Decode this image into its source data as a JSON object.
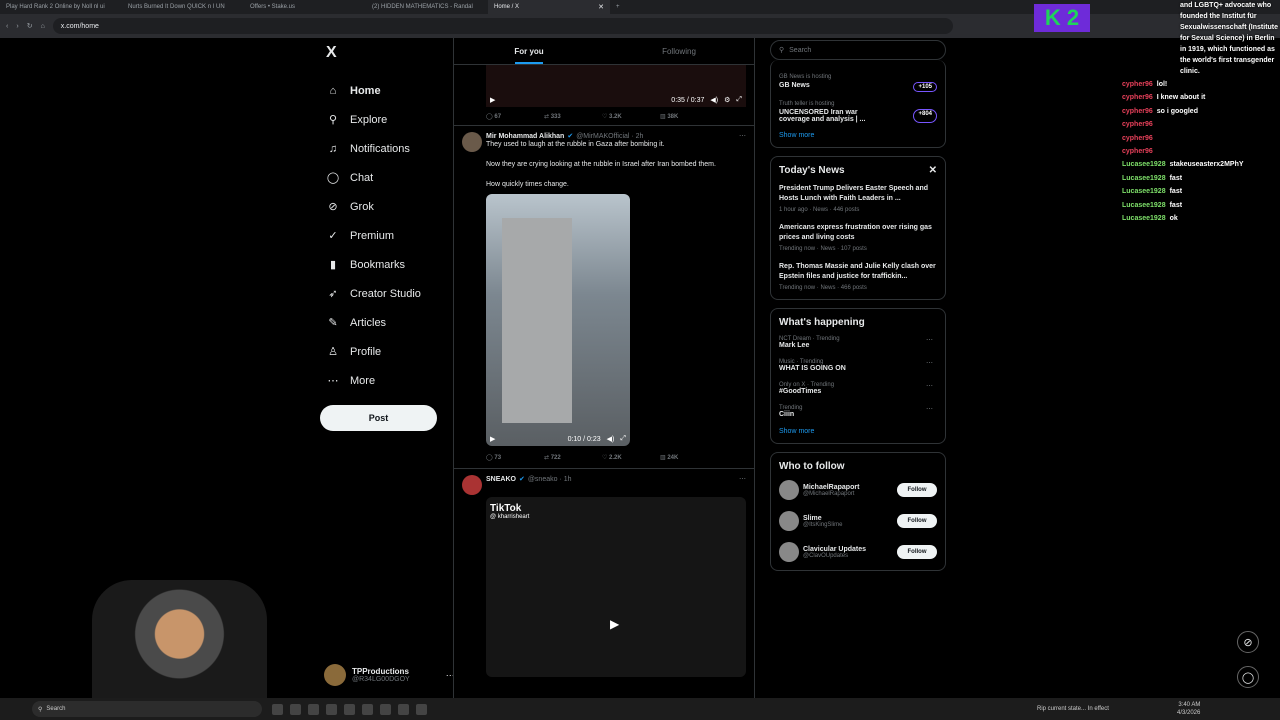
{
  "browser": {
    "tabs": [
      {
        "label": "Play Hard Rank 2 Online by Noll nl ui"
      },
      {
        "label": "Nurts Burned It Down QUICK n I UN"
      },
      {
        "label": "Offers • Stake.us"
      },
      {
        "label": "(2) HIDDEN MATHEMATICS - Randal"
      },
      {
        "label": "Home / X",
        "active": true
      }
    ],
    "url": "x.com/home",
    "new_tab": "+"
  },
  "nav": {
    "logo": "X",
    "items": [
      {
        "label": "Home",
        "icon": "home-icon"
      },
      {
        "label": "Explore",
        "icon": "search-icon"
      },
      {
        "label": "Notifications",
        "icon": "bell-icon"
      },
      {
        "label": "Chat",
        "icon": "chat-icon"
      },
      {
        "label": "Grok",
        "icon": "grok-icon"
      },
      {
        "label": "Premium",
        "icon": "verified-icon"
      },
      {
        "label": "Bookmarks",
        "icon": "bookmark-icon"
      },
      {
        "label": "Creator Studio",
        "icon": "rocket-icon"
      },
      {
        "label": "Articles",
        "icon": "article-icon"
      },
      {
        "label": "Profile",
        "icon": "person-icon"
      },
      {
        "label": "More",
        "icon": "more-icon"
      }
    ],
    "post_label": "Post",
    "account": {
      "name": "TPProductions",
      "handle": "@R34LG00DGOY"
    }
  },
  "feed": {
    "tabs": [
      "For you",
      "Following"
    ],
    "top_video": {
      "time": "0:35 / 0:37",
      "replies": "67",
      "reposts": "333",
      "likes": "3.2K",
      "views": "38K"
    },
    "tweet1": {
      "name": "Mir Mohammad Alikhan",
      "handle": "@MirMAKOfficial · 2h",
      "lines": [
        "They used to laugh at the rubble in Gaza after bombing it.",
        "Now they are crying looking at the rubble in Israel after Iran bombed them.",
        "How quickly times change."
      ],
      "time": "0:10 / 0:23",
      "replies": "73",
      "reposts": "722",
      "likes": "2.2K",
      "views": "24K"
    },
    "tweet2": {
      "name": "SNEAKO",
      "handle": "@sneako · 1h",
      "tiktok": "TikTok",
      "tiktok_user": "@ kharrisheart"
    }
  },
  "right": {
    "search_placeholder": "Search",
    "spaces": [
      {
        "host": "GB News",
        "status": "is hosting",
        "title": "GB News",
        "count": "+105"
      },
      {
        "host": "Truth teller",
        "status": "is hosting",
        "title": "UNCENSORED Iran war coverage and analysis | ...",
        "count": "+804"
      }
    ],
    "show_more": "Show more",
    "news_title": "Today's News",
    "news": [
      {
        "title": "President Trump Delivers Easter Speech and Hosts Lunch with Faith Leaders in ...",
        "meta": "1 hour ago · News · 446 posts"
      },
      {
        "title": "Americans express frustration over rising gas prices and living costs",
        "meta": "Trending now · News · 107 posts"
      },
      {
        "title": "Rep. Thomas Massie and Julie Kelly clash over Epstein files and justice for traffickin...",
        "meta": "Trending now · News · 466 posts"
      }
    ],
    "happening_title": "What's happening",
    "trends": [
      {
        "cat": "NCT Dream · Trending",
        "name": "Mark Lee"
      },
      {
        "cat": "Music · Trending",
        "name": "WHAT IS GOING ON"
      },
      {
        "cat": "Only on X · Trending",
        "name": "#GoodTimes"
      },
      {
        "cat": "Trending",
        "name": "Ciiin"
      }
    ],
    "wtf_title": "Who to follow",
    "wtf": [
      {
        "name": "MichaelRapaport",
        "handle": "@MichaelRapaport"
      },
      {
        "name": "Slime",
        "handle": "@ItsKingSlime"
      },
      {
        "name": "Clavicular Updates",
        "handle": "@ClavOUpdates"
      }
    ],
    "follow_label": "Follow"
  },
  "overlay": {
    "k2": "K 2",
    "chat_top": "and LGBTQ+ advocate who founded the Institut für Sexualwissenschaft (Institute for Sexual Science) in Berlin in 1919, which functioned as the world's first transgender clinic.",
    "chat": [
      {
        "user": "cypher96",
        "msg": "lol!",
        "c": "u"
      },
      {
        "user": "cypher96",
        "msg": "I knew about it",
        "c": "u"
      },
      {
        "user": "cypher96",
        "msg": "so i googled",
        "c": "u"
      },
      {
        "user": "cypher96",
        "msg": "",
        "c": "u"
      },
      {
        "user": "cypher96",
        "msg": "",
        "c": "u"
      },
      {
        "user": "cypher96",
        "msg": "",
        "c": "u"
      },
      {
        "user": "Lucasee1928",
        "msg": "stakeuseasterx2MPhY",
        "c": "l"
      },
      {
        "user": "Lucasee1928",
        "msg": "fast",
        "c": "l"
      },
      {
        "user": "Lucasee1928",
        "msg": "fast",
        "c": "l"
      },
      {
        "user": "Lucasee1928",
        "msg": "fast",
        "c": "l"
      },
      {
        "user": "Lucasee1928",
        "msg": "ok",
        "c": "l"
      }
    ]
  },
  "taskbar": {
    "search": "Search",
    "status": "Rip current state... In effect",
    "time": "3:40 AM",
    "date": "4/3/2026"
  },
  "colors": {
    "accent": "#1d9bf0",
    "bg": "#000000",
    "border": "#2f3336"
  }
}
